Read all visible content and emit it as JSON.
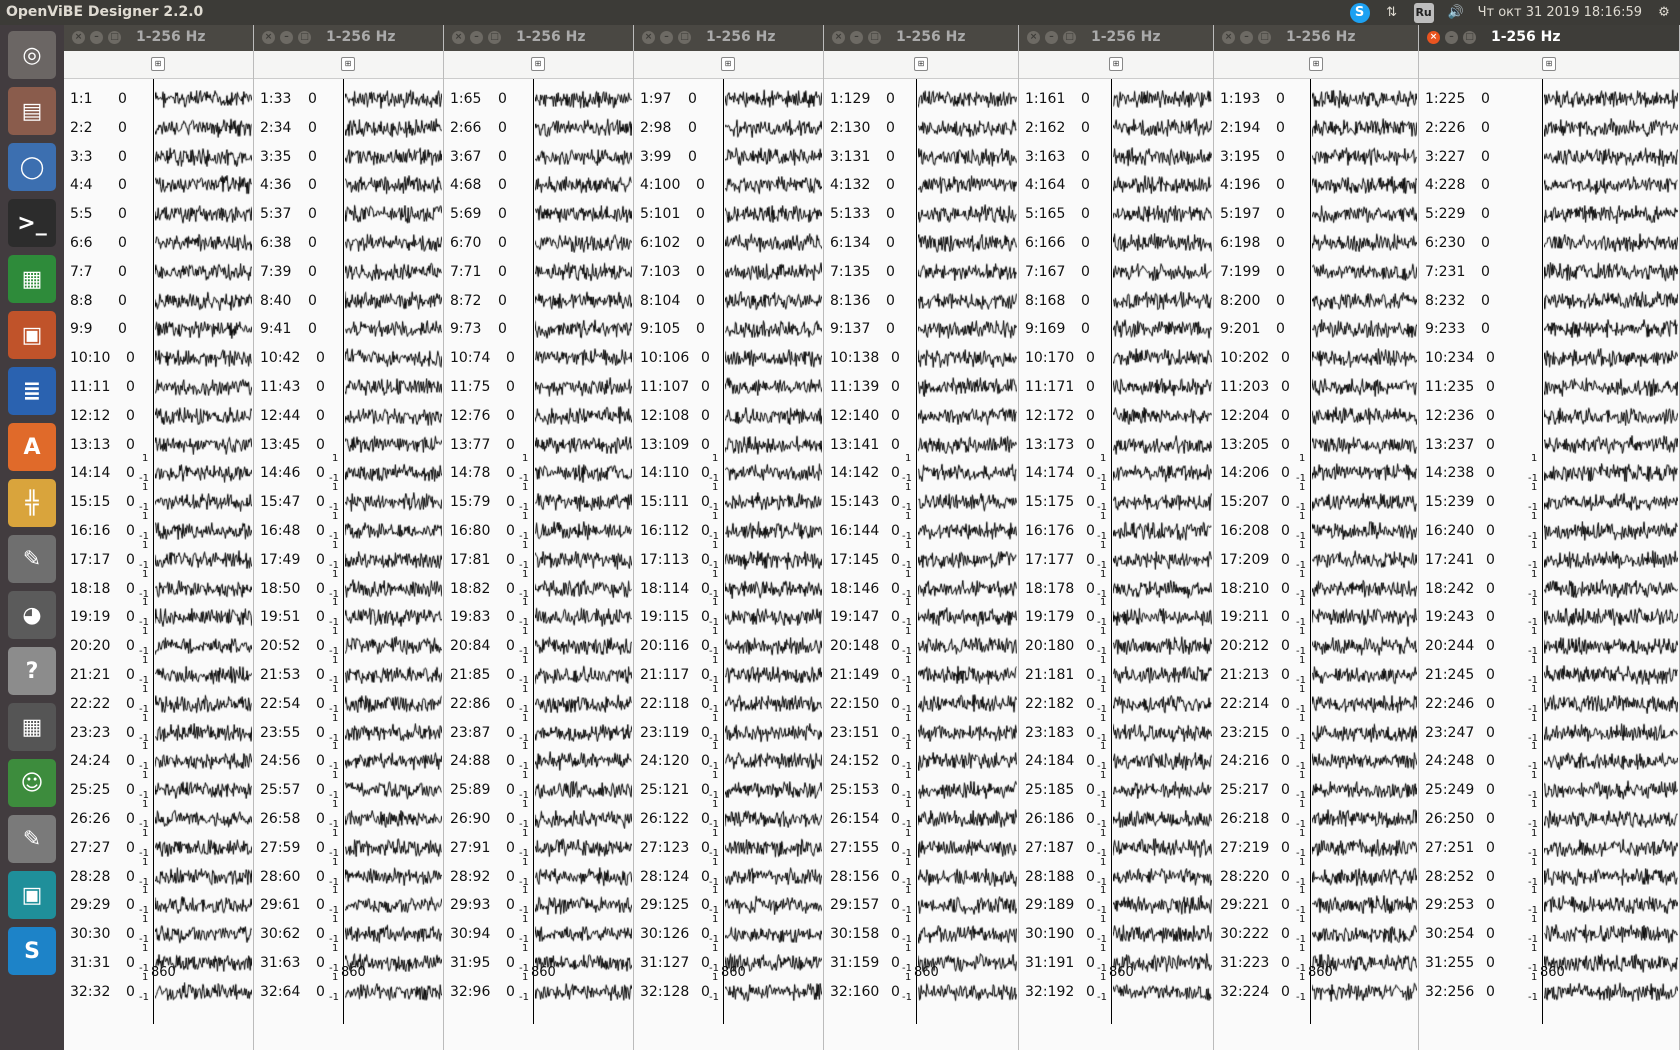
{
  "app": {
    "title": "OpenViBE Designer 2.2.0",
    "datetime": "Чт окт 31 2019 18:16:59",
    "skype_glyph": "S",
    "network_glyph": "⇅",
    "lang": "Ru",
    "volume_glyph": "🔊",
    "gear_glyph": "⚙"
  },
  "launcher": [
    {
      "name": "ubuntu-dash-icon",
      "glyph": "◎",
      "bg": "#6b6664"
    },
    {
      "name": "files-icon",
      "glyph": "▤",
      "bg": "#8a5c4c"
    },
    {
      "name": "chromium-icon",
      "glyph": "◯",
      "bg": "#3c6fb0"
    },
    {
      "name": "terminal-icon",
      "glyph": ">_",
      "bg": "#2c2c2c"
    },
    {
      "name": "calc-spreadsheet-icon",
      "glyph": "▦",
      "bg": "#2e8b3a"
    },
    {
      "name": "impress-icon",
      "glyph": "▣",
      "bg": "#c0532a"
    },
    {
      "name": "writer-icon",
      "glyph": "≣",
      "bg": "#2a62b0"
    },
    {
      "name": "software-center-icon",
      "glyph": "A",
      "bg": "#e06a2a"
    },
    {
      "name": "openvibe-designer-icon",
      "glyph": "╬",
      "bg": "#d9a43c"
    },
    {
      "name": "system-settings-icon",
      "glyph": "✎",
      "bg": "#6f6f6f"
    },
    {
      "name": "gimp-icon",
      "glyph": "◕",
      "bg": "#5b5b5b"
    },
    {
      "name": "help-icon",
      "glyph": "?",
      "bg": "#8c8c8c"
    },
    {
      "name": "calculator-icon",
      "glyph": "▦",
      "bg": "#555555"
    },
    {
      "name": "monkey-app-icon",
      "glyph": "☺",
      "bg": "#3d8c3d"
    },
    {
      "name": "text-editor-icon",
      "glyph": "✎",
      "bg": "#7a7a7a"
    },
    {
      "name": "app-window-icon",
      "glyph": "▣",
      "bg": "#1f8f9a"
    },
    {
      "name": "skype-launcher-icon",
      "glyph": "S",
      "bg": "#1d83c8"
    }
  ],
  "windows": [
    {
      "title": "1-256 Hz",
      "active": false,
      "xtick": "860",
      "labels": [
        "1:1",
        "2:2",
        "3:3",
        "4:4",
        "5:5",
        "6:6",
        "7:7",
        "8:8",
        "9:9",
        "10:10",
        "11:11",
        "12:12",
        "13:13",
        "14:14",
        "15:15",
        "16:16",
        "17:17",
        "18:18",
        "19:19",
        "20:20",
        "21:21",
        "22:22",
        "23:23",
        "24:24",
        "25:25",
        "26:26",
        "27:27",
        "28:28",
        "29:29",
        "30:30",
        "31:31",
        "32:32"
      ]
    },
    {
      "title": "1-256 Hz",
      "active": false,
      "xtick": "860",
      "labels": [
        "1:33",
        "2:34",
        "3:35",
        "4:36",
        "5:37",
        "6:38",
        "7:39",
        "8:40",
        "9:41",
        "10:42",
        "11:43",
        "12:44",
        "13:45",
        "14:46",
        "15:47",
        "16:48",
        "17:49",
        "18:50",
        "19:51",
        "20:52",
        "21:53",
        "22:54",
        "23:55",
        "24:56",
        "25:57",
        "26:58",
        "27:59",
        "28:60",
        "29:61",
        "30:62",
        "31:63",
        "32:64"
      ]
    },
    {
      "title": "1-256 Hz",
      "active": false,
      "xtick": "860",
      "labels": [
        "1:65",
        "2:66",
        "3:67",
        "4:68",
        "5:69",
        "6:70",
        "7:71",
        "8:72",
        "9:73",
        "10:74",
        "11:75",
        "12:76",
        "13:77",
        "14:78",
        "15:79",
        "16:80",
        "17:81",
        "18:82",
        "19:83",
        "20:84",
        "21:85",
        "22:86",
        "23:87",
        "24:88",
        "25:89",
        "26:90",
        "27:91",
        "28:92",
        "29:93",
        "30:94",
        "31:95",
        "32:96"
      ]
    },
    {
      "title": "1-256 Hz",
      "active": false,
      "xtick": "860",
      "labels": [
        "1:97",
        "2:98",
        "3:99",
        "4:100",
        "5:101",
        "6:102",
        "7:103",
        "8:104",
        "9:105",
        "10:106",
        "11:107",
        "12:108",
        "13:109",
        "14:110",
        "15:111",
        "16:112",
        "17:113",
        "18:114",
        "19:115",
        "20:116",
        "21:117",
        "22:118",
        "23:119",
        "24:120",
        "25:121",
        "26:122",
        "27:123",
        "28:124",
        "29:125",
        "30:126",
        "31:127",
        "32:128"
      ]
    },
    {
      "title": "1-256 Hz",
      "active": false,
      "xtick": "860",
      "labels": [
        "1:129",
        "2:130",
        "3:131",
        "4:132",
        "5:133",
        "6:134",
        "7:135",
        "8:136",
        "9:137",
        "10:138",
        "11:139",
        "12:140",
        "13:141",
        "14:142",
        "15:143",
        "16:144",
        "17:145",
        "18:146",
        "19:147",
        "20:148",
        "21:149",
        "22:150",
        "23:151",
        "24:152",
        "25:153",
        "26:154",
        "27:155",
        "28:156",
        "29:157",
        "30:158",
        "31:159",
        "32:160"
      ]
    },
    {
      "title": "1-256 Hz",
      "active": false,
      "xtick": "860",
      "labels": [
        "1:161",
        "2:162",
        "3:163",
        "4:164",
        "5:165",
        "6:166",
        "7:167",
        "8:168",
        "9:169",
        "10:170",
        "11:171",
        "12:172",
        "13:173",
        "14:174",
        "15:175",
        "16:176",
        "17:177",
        "18:178",
        "19:179",
        "20:180",
        "21:181",
        "22:182",
        "23:183",
        "24:184",
        "25:185",
        "26:186",
        "27:187",
        "28:188",
        "29:189",
        "30:190",
        "31:191",
        "32:192"
      ]
    },
    {
      "title": "1-256 Hz",
      "active": false,
      "xtick": "860",
      "labels": [
        "1:193",
        "2:194",
        "3:195",
        "4:196",
        "5:197",
        "6:198",
        "7:199",
        "8:200",
        "9:201",
        "10:202",
        "11:203",
        "12:204",
        "13:205",
        "14:206",
        "15:207",
        "16:208",
        "17:209",
        "18:210",
        "19:211",
        "20:212",
        "21:213",
        "22:214",
        "23:215",
        "24:216",
        "25:217",
        "26:218",
        "27:219",
        "28:220",
        "29:221",
        "30:222",
        "31:223",
        "32:224"
      ]
    },
    {
      "title": "1-256 Hz",
      "active": true,
      "xtick": "860",
      "labels": [
        "1:225",
        "2:226",
        "3:227",
        "4:228",
        "5:229",
        "6:230",
        "7:231",
        "8:232",
        "9:233",
        "10:234",
        "11:235",
        "12:236",
        "13:237",
        "14:238",
        "15:239",
        "16:240",
        "17:241",
        "18:242",
        "19:243",
        "20:244",
        "21:245",
        "22:246",
        "23:247",
        "24:248",
        "25:249",
        "26:250",
        "27:251",
        "28:252",
        "29:253",
        "30:254",
        "31:255",
        "32:256"
      ]
    }
  ],
  "value_zero": "0",
  "value_one": "1",
  "value_neg_one": "-1",
  "toolbar_glyph": "⊞",
  "window_controls": {
    "close": "×",
    "minimize": "–",
    "maximize": "□"
  }
}
